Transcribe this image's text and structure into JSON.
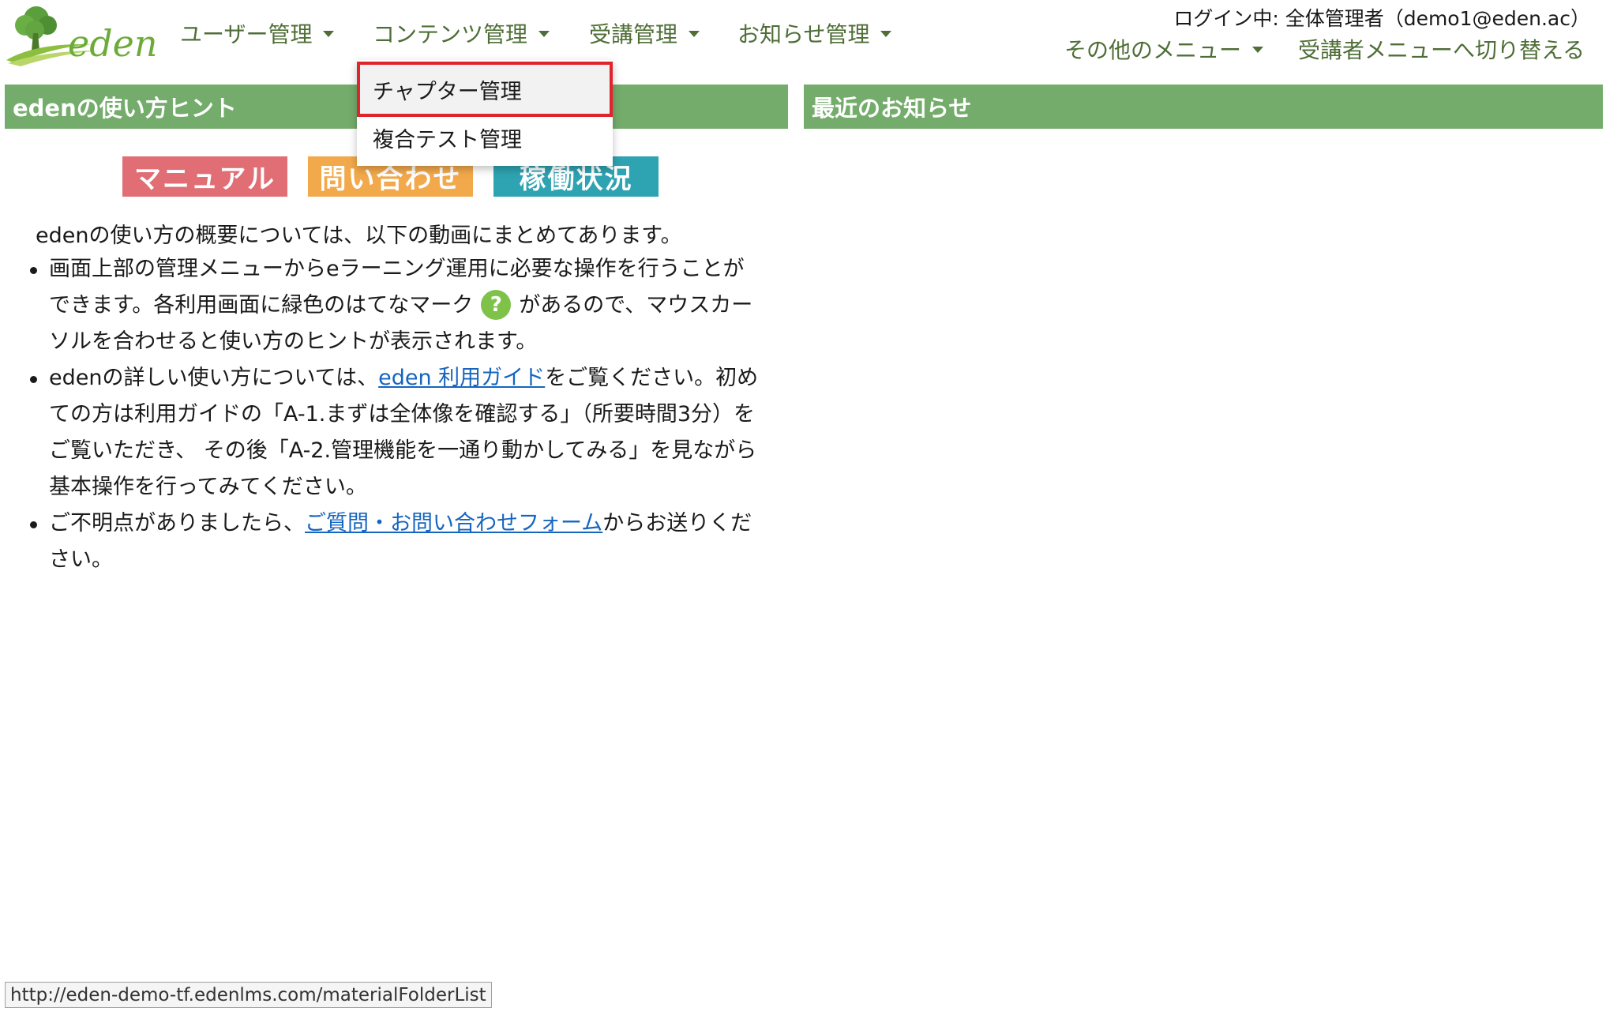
{
  "header": {
    "logo_text": "eden",
    "nav": [
      {
        "label": "ユーザー管理"
      },
      {
        "label": "コンテンツ管理"
      },
      {
        "label": "受講管理"
      },
      {
        "label": "お知らせ管理"
      }
    ],
    "login_status": "ログイン中: 全体管理者（demo1@eden.ac）",
    "other_menu_label": "その他のメニュー",
    "switch_label": "受講者メニューへ切り替える"
  },
  "dropdown": {
    "items": [
      {
        "label": "チャプター管理"
      },
      {
        "label": "複合テスト管理"
      }
    ]
  },
  "left_panel": {
    "title": "edenの使い方ヒント",
    "buttons": [
      {
        "label": "マニュアル"
      },
      {
        "label": "問い合わせ"
      },
      {
        "label": "稼働状況"
      }
    ],
    "intro": "edenの使い方の概要については、以下の動画にまとめてあります。",
    "bullets": [
      {
        "lines": [
          "画面上部の管理メニューからeラーニング運用に必要な操作を行うことが"
        ],
        "line2_before": "できます。各利用画面に緑色のはてなマーク",
        "line2_after": "があるので、マウスカー",
        "line3": "ソルを合わせると使い方のヒントが表示されます。"
      },
      {
        "before_link": "edenの詳しい使い方については、",
        "link": "eden 利用ガイド",
        "after_link": "をご覧ください。初め",
        "line2": "ての方は利用ガイドの「A-1.まずは全体像を確認する」（所要時間3分）を",
        "line3": "ご覧いただき、 その後「A-2.管理機能を一通り動かしてみる」を見ながら",
        "line4": "基本操作を行ってみてください。"
      },
      {
        "before_link": "ご不明点がありましたら、",
        "link": "ご質問・お問い合わせフォーム",
        "after_link": "からお送りくだ",
        "line2": "さい。"
      }
    ]
  },
  "right_panel": {
    "title": "最近のお知らせ"
  },
  "statusbar": {
    "url": "http://eden-demo-tf.edenlms.com/materialFolderList"
  },
  "colors": {
    "accent_green": "#74ac6b",
    "nav_text": "#4f6e37",
    "highlight_border": "#e0242c",
    "link": "#1565c0"
  }
}
